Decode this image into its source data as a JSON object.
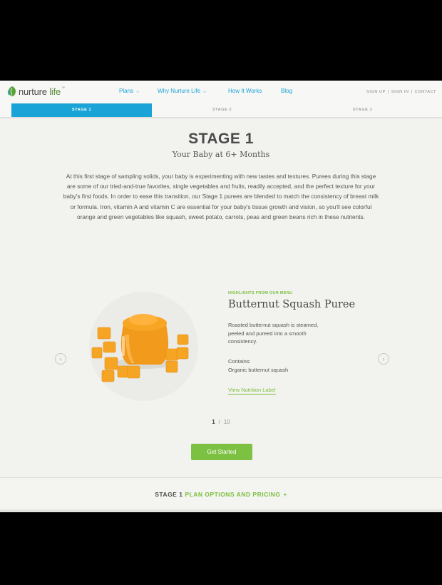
{
  "header": {
    "logo": {
      "text_main": "nurture",
      "text_accent": "life",
      "tm": "™"
    },
    "nav": [
      {
        "label": "Plans",
        "has_caret": true
      },
      {
        "label": "Why Nurture Life",
        "has_caret": true
      },
      {
        "label": "How It Works",
        "has_caret": false
      },
      {
        "label": "Blog",
        "has_caret": false
      }
    ],
    "utility": {
      "sign_up": "SIGN UP",
      "sign_in": "SIGN IN",
      "contact": "CONTACT",
      "separator": "|"
    }
  },
  "tabs": [
    {
      "label": "STAGE 1",
      "active": true
    },
    {
      "label": "STAGE 2",
      "active": false
    },
    {
      "label": "STAGE 3",
      "active": false
    }
  ],
  "main": {
    "title": "STAGE 1",
    "subtitle": "Your Baby at 6+ Months",
    "intro": "At this first stage of sampling solids, your baby is experimenting with new tastes and textures. Purees during this stage are some of our tried-and-true favorites, single vegetables and fruits, readily accepted, and the perfect texture for your baby's first foods. In order to ease this transition, our Stage 1 purees are blended to match the consistency of breast milk or formula. Iron, vitamin A and vitamin C are essential for your baby's tissue growth and vision, so you'll see colorful orange and green vegetables like squash, sweet potato, carrots, peas and green beans rich in these nutrients."
  },
  "carousel": {
    "highlight_label": "HIGHLIGHTS FROM OUR MENU",
    "dish_name": "Butternut Squash Puree",
    "description": "Roasted butternut squash is steamed, peeled and pureed into a smooth consistency.",
    "contains_label": "Contains:",
    "contains_value": "Organic butternut squash",
    "nutrition_link": "View Nutrition Label",
    "prev_icon": "‹",
    "next_icon": "›",
    "pager": {
      "current": "1",
      "separator": "/",
      "total": "10"
    }
  },
  "cta": {
    "label": "Get Started"
  },
  "footer": {
    "stage_text": "STAGE 1",
    "plan_text": "PLAN OPTIONS AND PRICING",
    "plus": "+"
  },
  "colors": {
    "accent_blue": "#1aa3d6",
    "accent_green": "#7dc142",
    "text_dark": "#4a4a4a"
  }
}
